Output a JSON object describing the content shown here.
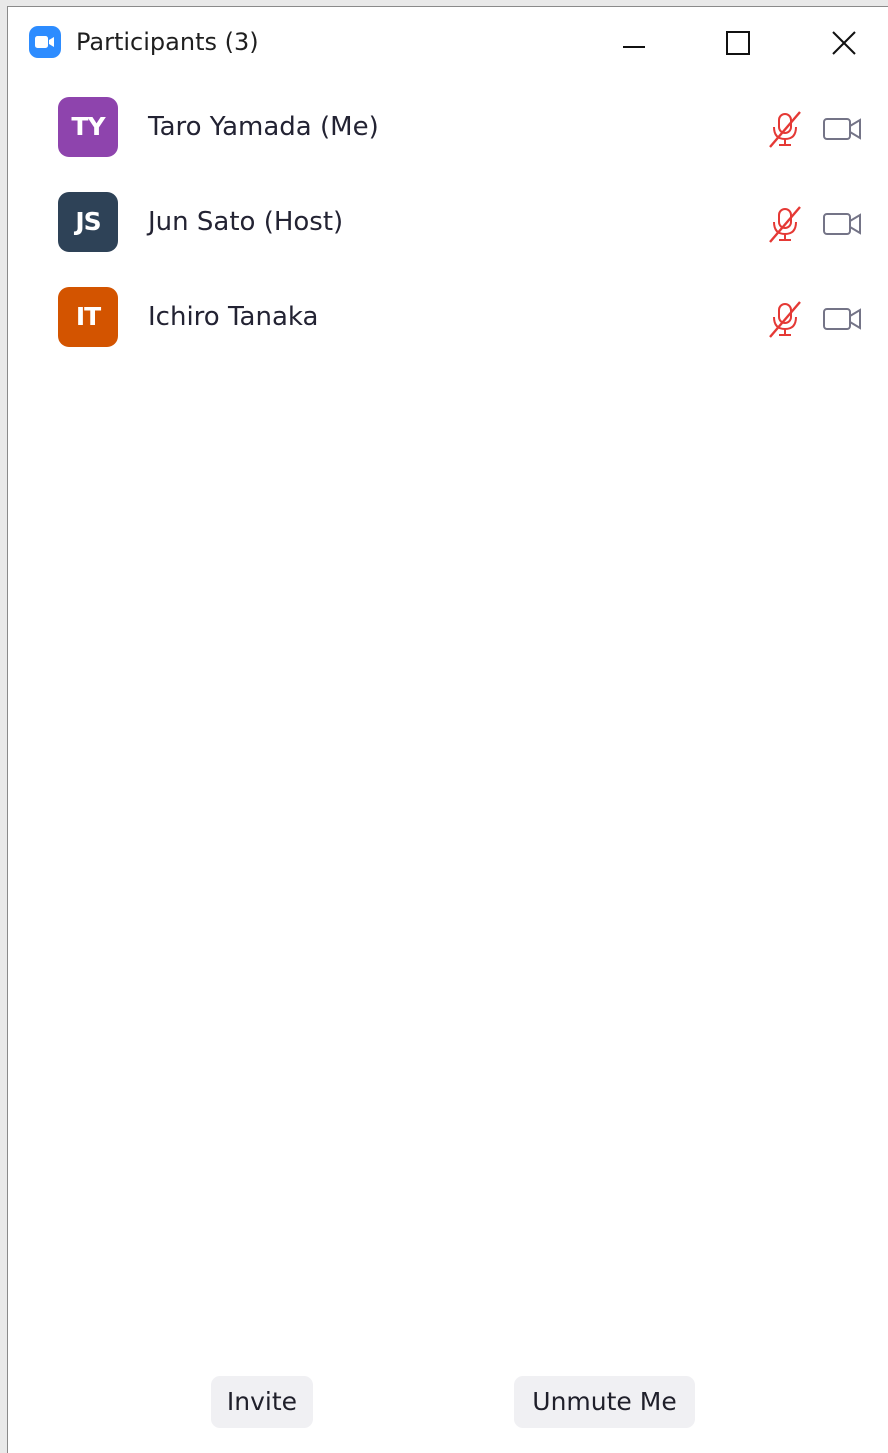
{
  "window": {
    "title": "Participants (3)",
    "icons": {
      "app": "zoom-camera-icon",
      "minimize": "minimize-icon",
      "maximize": "maximize-icon",
      "close": "close-icon"
    }
  },
  "participants": [
    {
      "initials": "TY",
      "name": "Taro Yamada (Me)",
      "avatar_color": "#8e44ad",
      "mic": "muted",
      "video": "off"
    },
    {
      "initials": "JS",
      "name": "Jun Sato (Host)",
      "avatar_color": "#2e4257",
      "mic": "muted",
      "video": "off"
    },
    {
      "initials": "IT",
      "name": "Ichiro Tanaka",
      "avatar_color": "#d35400",
      "mic": "muted",
      "video": "off"
    }
  ],
  "colors": {
    "muted_icon": "#e53935",
    "video_icon": "#747487",
    "accent": "#2d8cff"
  },
  "footer": {
    "invite_label": "Invite",
    "unmute_label": "Unmute Me"
  }
}
